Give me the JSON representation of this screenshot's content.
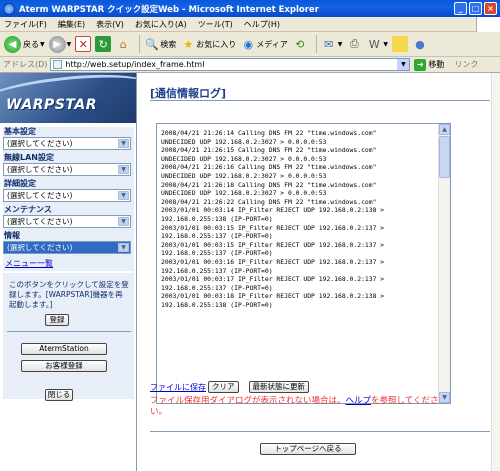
{
  "window": {
    "title": "Aterm WARPSTAR クイック設定Web - Microsoft Internet Explorer"
  },
  "menubar": {
    "items": [
      "ファイル(F)",
      "編集(E)",
      "表示(V)",
      "お気に入り(A)",
      "ツール(T)",
      "ヘルプ(H)"
    ]
  },
  "toolbar": {
    "back": "戻る",
    "search": "検索",
    "favorites": "お気に入り",
    "media": "メディア"
  },
  "address": {
    "label": "アドレス(D)",
    "url": "http://web.setup/index_frame.html",
    "go": "移動",
    "links": "リンク"
  },
  "sidebar": {
    "logo": "WARPSTAR",
    "sections": [
      {
        "label": "基本設定",
        "value": "(選択してください)"
      },
      {
        "label": "無線LAN設定",
        "value": "(選択してください)"
      },
      {
        "label": "詳細設定",
        "value": "(選択してください)"
      },
      {
        "label": "メンテナンス",
        "value": "(選択してください)"
      },
      {
        "label": "情報",
        "value": "(選択してください)"
      }
    ],
    "menu_list": "メニュー一覧",
    "notice": "このボタンをクリックして設定を登録します。[WARPSTAR]機器を再起動します。]",
    "register_button": "登録",
    "aterm_station_button": "AtermStation",
    "support_button": "お客様登録",
    "close_button": "閉じる"
  },
  "main": {
    "title": "[通信情報ログ]",
    "log_lines": [
      "2008/04/21 21:26:14 Calling DNS FM 22 \"time.windows.com\"",
      "UNDECIDED UDP 192.168.0.2:3027 > 0.0.0.0:53",
      "2008/04/21 21:26:15 Calling DNS FM 22 \"time.windows.com\"",
      "UNDECIDED UDP 192.168.0.2:3027 > 0.0.0.0:53",
      "2008/04/21 21:26:16 Calling DNS FM 22 \"time.windows.com\"",
      "UNDECIDED UDP 192.168.0.2:3027 > 0.0.0.0:53",
      "2008/04/21 21:26:18 Calling DNS FM 22 \"time.windows.com\"",
      "UNDECIDED UDP 192.168.0.2:3027 > 0.0.0.0:53",
      "2008/04/21 21:26:22 Calling DNS FM 22 \"time.windows.com\"",
      "2003/01/01 00:03:14 IP_Filter REJECT UDP 192.168.0.2:138 >",
      "192.168.0.255:138 (IP-PORT=0)",
      "2003/01/01 00:03:15 IP_Filter REJECT UDP 192.168.0.2:137 >",
      "192.168.0.255:137 (IP-PORT=0)",
      "2003/01/01 00:03:15 IP_Filter REJECT UDP 192.168.0.2:137 >",
      "192.168.0.255:137 (IP-PORT=0)",
      "2003/01/01 00:03:16 IP_Filter REJECT UDP 192.168.0.2:137 >",
      "192.168.0.255:137 (IP-PORT=0)",
      "2003/01/01 00:03:17 IP_Filter REJECT UDP 192.168.0.2:137 >",
      "192.168.0.255:137 (IP-PORT=0)",
      "2003/01/01 00:03:18 IP_Filter REJECT UDP 192.168.0.2:138 >",
      "192.168.0.255:138 (IP-PORT=0)"
    ],
    "save_link": "ファイルに保存",
    "clear_button": "クリア",
    "refresh_button": "最新状態に更新",
    "warning_prefix": "ファイル保存用ダイアログが表示されない場合は、",
    "warning_link": "ヘルプ",
    "warning_suffix": "を参照してください。",
    "top_page_button": "トップページへ戻る"
  }
}
